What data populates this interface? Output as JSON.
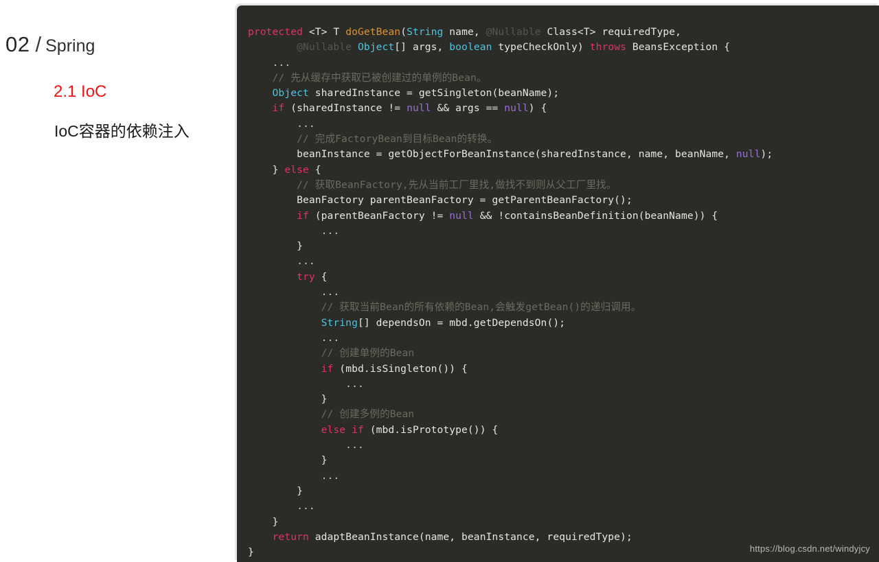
{
  "outline": {
    "chapter_number": "02",
    "separator": "/",
    "chapter_name": "Spring",
    "section_number_title": "2.1 IoC",
    "section_description": "IoC容器的依赖注入",
    "accent_color": "#f01414",
    "title_color": "#262626"
  },
  "code_panel": {
    "language": "java",
    "background_color": "#2b2b28",
    "watermark": "https://blog.csdn.net/windyjcy",
    "theme": {
      "keyword": "#e0316c",
      "type": "#4ec3e0",
      "method": "#d9952b",
      "null_literal": "#9a6fd4",
      "comment": "#6b6b5f",
      "annotation": "#545450",
      "plain": "#e6e6e6"
    },
    "lines": [
      [
        {
          "t": "protected",
          "c": "k"
        },
        {
          "t": " <T> T ",
          "c": "pl"
        },
        {
          "t": "doGetBean",
          "c": "fn"
        },
        {
          "t": "(",
          "c": "pl"
        },
        {
          "t": "String",
          "c": "ty"
        },
        {
          "t": " name, ",
          "c": "pl"
        },
        {
          "t": "@Nullable",
          "c": "an"
        },
        {
          "t": " Class<T> requiredType,",
          "c": "pl"
        }
      ],
      [
        {
          "t": "        ",
          "c": "pl"
        },
        {
          "t": "@Nullable",
          "c": "an"
        },
        {
          "t": " ",
          "c": "pl"
        },
        {
          "t": "Object",
          "c": "ty"
        },
        {
          "t": "[] args, ",
          "c": "pl"
        },
        {
          "t": "boolean",
          "c": "ty"
        },
        {
          "t": " typeCheckOnly) ",
          "c": "pl"
        },
        {
          "t": "throws",
          "c": "k"
        },
        {
          "t": " BeansException {",
          "c": "pl"
        }
      ],
      [
        {
          "t": "    ...",
          "c": "dots"
        }
      ],
      [
        {
          "t": "    // 先从缓存中获取已被创建过的单例的Bean。",
          "c": "cm"
        }
      ],
      [
        {
          "t": "    ",
          "c": "pl"
        },
        {
          "t": "Object",
          "c": "ty"
        },
        {
          "t": " sharedInstance = getSingleton(beanName);",
          "c": "pl"
        }
      ],
      [
        {
          "t": "    ",
          "c": "pl"
        },
        {
          "t": "if",
          "c": "k"
        },
        {
          "t": " (sharedInstance != ",
          "c": "pl"
        },
        {
          "t": "null",
          "c": "nul"
        },
        {
          "t": " && args == ",
          "c": "pl"
        },
        {
          "t": "null",
          "c": "nul"
        },
        {
          "t": ") {",
          "c": "pl"
        }
      ],
      [
        {
          "t": "        ...",
          "c": "dots"
        }
      ],
      [
        {
          "t": "        // 完成FactoryBean到目标Bean的转换。",
          "c": "cm"
        }
      ],
      [
        {
          "t": "        beanInstance = getObjectForBeanInstance(sharedInstance, name, beanName, ",
          "c": "pl"
        },
        {
          "t": "null",
          "c": "nul"
        },
        {
          "t": ");",
          "c": "pl"
        }
      ],
      [
        {
          "t": "    } ",
          "c": "pl"
        },
        {
          "t": "else",
          "c": "k"
        },
        {
          "t": " {",
          "c": "pl"
        }
      ],
      [
        {
          "t": "        // 获取BeanFactory,先从当前工厂里找,做找不到则从父工厂里找。",
          "c": "cm"
        }
      ],
      [
        {
          "t": "        BeanFactory parentBeanFactory = getParentBeanFactory();",
          "c": "pl"
        }
      ],
      [
        {
          "t": "        ",
          "c": "pl"
        },
        {
          "t": "if",
          "c": "k"
        },
        {
          "t": " (parentBeanFactory != ",
          "c": "pl"
        },
        {
          "t": "null",
          "c": "nul"
        },
        {
          "t": " && !containsBeanDefinition(beanName)) {",
          "c": "pl"
        }
      ],
      [
        {
          "t": "            ...",
          "c": "dots"
        }
      ],
      [
        {
          "t": "        }",
          "c": "pl"
        }
      ],
      [
        {
          "t": "        ...",
          "c": "dots"
        }
      ],
      [
        {
          "t": "        ",
          "c": "pl"
        },
        {
          "t": "try",
          "c": "k"
        },
        {
          "t": " {",
          "c": "pl"
        }
      ],
      [
        {
          "t": "            ...",
          "c": "dots"
        }
      ],
      [
        {
          "t": "            // 获取当前Bean的所有依赖的Bean,会触发getBean()的递归调用。",
          "c": "cm"
        }
      ],
      [
        {
          "t": "            ",
          "c": "pl"
        },
        {
          "t": "String",
          "c": "ty"
        },
        {
          "t": "[] dependsOn = mbd.getDependsOn();",
          "c": "pl"
        }
      ],
      [
        {
          "t": "            ...",
          "c": "dots"
        }
      ],
      [
        {
          "t": "            // 创建单例的Bean",
          "c": "cm"
        }
      ],
      [
        {
          "t": "            ",
          "c": "pl"
        },
        {
          "t": "if",
          "c": "k"
        },
        {
          "t": " (mbd.isSingleton()) {",
          "c": "pl"
        }
      ],
      [
        {
          "t": "                ...",
          "c": "dots"
        }
      ],
      [
        {
          "t": "            }",
          "c": "pl"
        }
      ],
      [
        {
          "t": "            // 创建多例的Bean",
          "c": "cm"
        }
      ],
      [
        {
          "t": "            ",
          "c": "pl"
        },
        {
          "t": "else",
          "c": "k"
        },
        {
          "t": " ",
          "c": "pl"
        },
        {
          "t": "if",
          "c": "k"
        },
        {
          "t": " (mbd.isPrototype()) {",
          "c": "pl"
        }
      ],
      [
        {
          "t": "                ...",
          "c": "dots"
        }
      ],
      [
        {
          "t": "            }",
          "c": "pl"
        }
      ],
      [
        {
          "t": "            ...",
          "c": "dots"
        }
      ],
      [
        {
          "t": "        }",
          "c": "pl"
        }
      ],
      [
        {
          "t": "        ...",
          "c": "dots"
        }
      ],
      [
        {
          "t": "    }",
          "c": "pl"
        }
      ],
      [
        {
          "t": "    ",
          "c": "pl"
        },
        {
          "t": "return",
          "c": "k"
        },
        {
          "t": " adaptBeanInstance(name, beanInstance, requiredType);",
          "c": "pl"
        }
      ],
      [
        {
          "t": "}",
          "c": "pl"
        }
      ]
    ]
  }
}
